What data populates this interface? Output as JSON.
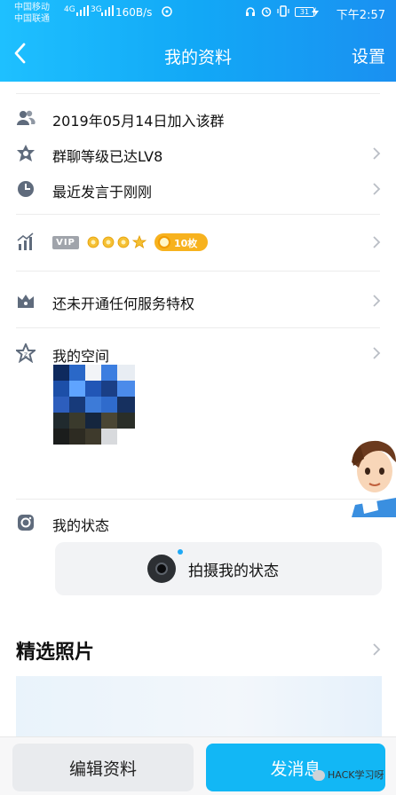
{
  "status_bar": {
    "carrier1": "中国移动",
    "carrier2": "中国联通",
    "net1": "4G",
    "net2": "3G",
    "speed": "160B/s",
    "battery": "31",
    "time": "下午2:57"
  },
  "nav": {
    "title": "我的资料",
    "settings_label": "设置"
  },
  "rows": {
    "joined": "2019年05月14日加入该群",
    "level": "群聊等级已达LV8",
    "last_speak": "最近发言于刚刚",
    "vip_badge": "VIP",
    "coins": "10枚",
    "service": "还未开通任何服务特权",
    "space": "我的空间",
    "status": "我的状态"
  },
  "story": {
    "label": "拍摄我的状态"
  },
  "photos": {
    "title": "精选照片"
  },
  "bottom": {
    "edit_label": "编辑资料",
    "message_label": "发消息",
    "watermark": "HACK学习呀"
  },
  "colors": {
    "header_start": "#1ec0ff",
    "header_end": "#1a90f1",
    "primary_button": "#12b7f5",
    "icon_gray": "#5f6b7c",
    "coin_orange": "#f7b21e"
  }
}
